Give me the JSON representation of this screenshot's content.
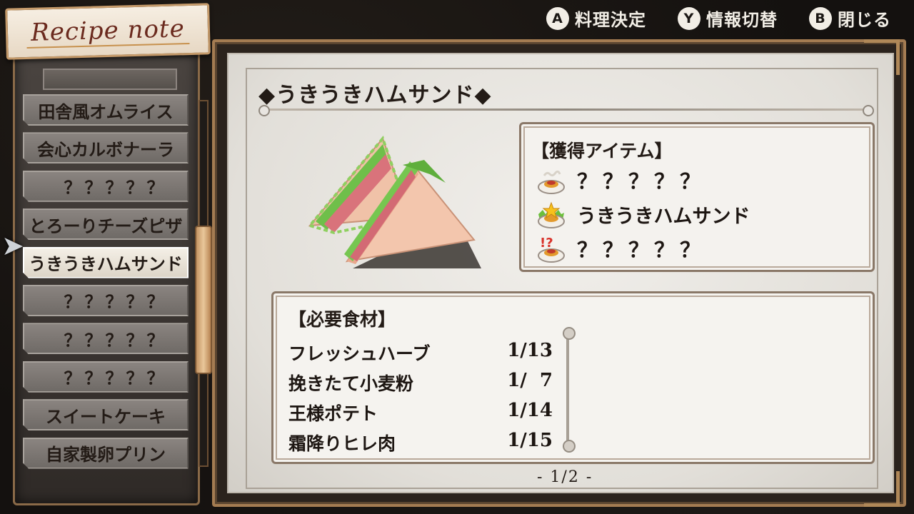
{
  "hints": [
    {
      "button": "A",
      "label": "料理決定"
    },
    {
      "button": "Y",
      "label": "情報切替"
    },
    {
      "button": "B",
      "label": "閉じる"
    }
  ],
  "title_tag": "Recipe note",
  "recipe_list": [
    {
      "label": "田舎風オムライス",
      "known": true,
      "selected": false
    },
    {
      "label": "会心カルボナーラ",
      "known": true,
      "selected": false
    },
    {
      "label": "？？？？？",
      "known": false,
      "selected": false
    },
    {
      "label": "とろーりチーズピザ",
      "known": true,
      "selected": false
    },
    {
      "label": "うきうきハムサンド",
      "known": true,
      "selected": true
    },
    {
      "label": "？？？？？",
      "known": false,
      "selected": false
    },
    {
      "label": "？？？？？",
      "known": false,
      "selected": false
    },
    {
      "label": "？？？？？",
      "known": false,
      "selected": false
    },
    {
      "label": "スイートケーキ",
      "known": true,
      "selected": false
    },
    {
      "label": "自家製卵プリン",
      "known": true,
      "selected": false
    }
  ],
  "detail": {
    "title": "◆うきうきハムサンド◆",
    "items_heading": "【獲得アイテム】",
    "items": [
      {
        "icon": "steaming-dish-icon",
        "name": "？？？？？"
      },
      {
        "icon": "star-dish-icon",
        "name": "うきうきハムサンド"
      },
      {
        "icon": "surprise-dish-icon",
        "name": "？？？？？"
      }
    ],
    "ingredients_heading": "【必要食材】",
    "ingredients": [
      {
        "name": "フレッシュハーブ",
        "qty": "1/13"
      },
      {
        "name": "挽きたて小麦粉",
        "qty": "1/  7"
      },
      {
        "name": "王様ポテト",
        "qty": "1/14"
      },
      {
        "name": "霜降りヒレ肉",
        "qty": "1/15"
      }
    ],
    "page": "- 1/2 -"
  }
}
